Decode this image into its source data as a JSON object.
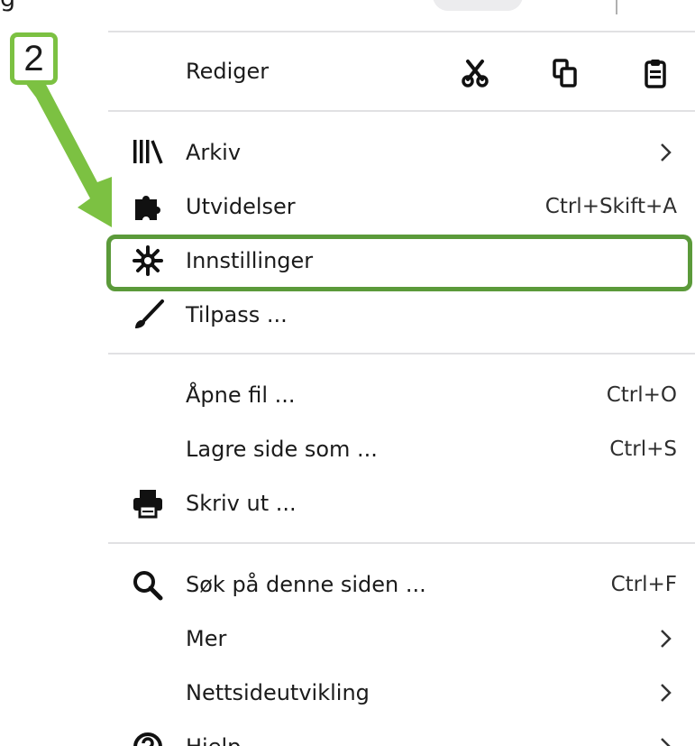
{
  "annotation": {
    "step_number": "2",
    "color": "#7cc142",
    "highlight_color": "#5b9a3a"
  },
  "menu": {
    "edit_row": {
      "label": "Rediger",
      "buttons": [
        {
          "name": "cut",
          "icon": "scissors-icon"
        },
        {
          "name": "copy",
          "icon": "copy-icon"
        },
        {
          "name": "paste",
          "icon": "clipboard-icon"
        }
      ]
    },
    "items": [
      {
        "label": "Arkiv",
        "icon": "library-icon",
        "shortcut": "",
        "submenu": true
      },
      {
        "label": "Utvidelser",
        "icon": "puzzle-icon",
        "shortcut": "Ctrl+Skift+A",
        "submenu": false
      },
      {
        "label": "Innstillinger",
        "icon": "gear-icon",
        "shortcut": "",
        "submenu": false,
        "highlighted": true
      },
      {
        "label": "Tilpass ...",
        "icon": "paintbrush-icon",
        "shortcut": "",
        "submenu": false
      },
      {
        "label": "Åpne fil ...",
        "icon": "",
        "shortcut": "Ctrl+O",
        "submenu": false
      },
      {
        "label": "Lagre side som ...",
        "icon": "",
        "shortcut": "Ctrl+S",
        "submenu": false
      },
      {
        "label": "Skriv ut ...",
        "icon": "printer-icon",
        "shortcut": "",
        "submenu": false
      },
      {
        "label": "Søk på denne siden ...",
        "icon": "search-icon",
        "shortcut": "Ctrl+F",
        "submenu": false
      },
      {
        "label": "Mer",
        "icon": "",
        "shortcut": "",
        "submenu": true
      },
      {
        "label": "Nettsideutvikling",
        "icon": "",
        "shortcut": "",
        "submenu": true
      },
      {
        "label": "Hjelp",
        "icon": "help-icon",
        "shortcut": "",
        "submenu": true
      }
    ]
  }
}
